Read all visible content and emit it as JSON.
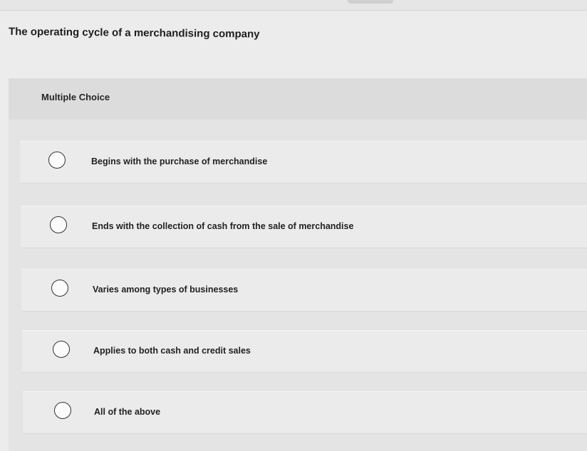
{
  "question": {
    "text": "The operating cycle of a merchandising company"
  },
  "choices_panel": {
    "label": "Multiple Choice",
    "options": [
      {
        "label": "Begins with the purchase of merchandise"
      },
      {
        "label": "Ends with the collection of cash from the sale of merchandise"
      },
      {
        "label": "Varies among types of businesses"
      },
      {
        "label": "Applies to both cash and credit sales"
      },
      {
        "label": "All of the above"
      }
    ]
  },
  "colors": {
    "page_background": "#ececec",
    "panel_background": "#e4e4e4",
    "text": "#222222"
  },
  "icons": {
    "option_marker": "radio-button-empty-icon"
  }
}
